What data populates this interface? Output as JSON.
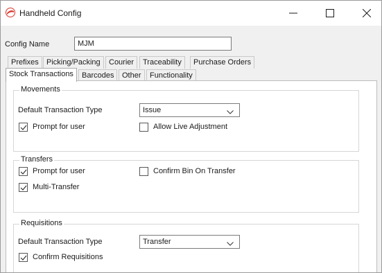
{
  "window": {
    "title": "Handheld Config",
    "icon": "app-logo-icon",
    "controls": [
      "minimize-icon",
      "maximize-icon",
      "close-icon"
    ]
  },
  "config_name": {
    "label": "Config Name",
    "value": "MJM"
  },
  "tabs_row1": [
    "Prefixes",
    "Picking/Packing",
    "Courier",
    "Traceability",
    "Purchase Orders"
  ],
  "tabs_row2": [
    "Stock Transactions",
    "Barcodes",
    "Other",
    "Functionality"
  ],
  "active_tab": "Stock Transactions",
  "movements": {
    "title": "Movements",
    "default_type_label": "Default Transaction Type",
    "default_type_value": "Issue",
    "prompt_for_user": {
      "label": "Prompt for user",
      "checked": true
    },
    "allow_live_adjustment": {
      "label": "Allow Live Adjustment",
      "checked": false
    }
  },
  "transfers": {
    "title": "Transfers",
    "prompt_for_user": {
      "label": "Prompt for user",
      "checked": true
    },
    "confirm_bin_on_transfer": {
      "label": "Confirm Bin On Transfer",
      "checked": false
    },
    "multi_transfer": {
      "label": "Multi-Transfer",
      "checked": true
    }
  },
  "requisitions": {
    "title": "Requisitions",
    "default_type_label": "Default Transaction Type",
    "default_type_value": "Transfer",
    "confirm_requisitions": {
      "label": "Confirm Requisitions",
      "checked": true
    }
  },
  "colors": {
    "window_bg": "#f0f0f0",
    "panel_bg": "#ffffff",
    "app_icon_red": "#d9342b"
  }
}
